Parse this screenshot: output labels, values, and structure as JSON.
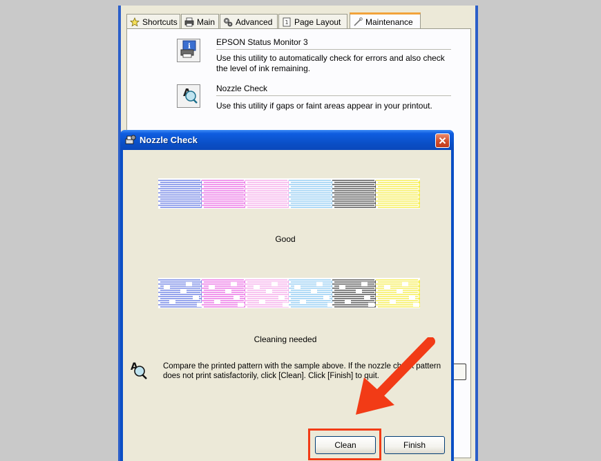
{
  "colors": {
    "backdrop": "#c9c9c9",
    "dialog_blue": "#0a4ec5",
    "highlight": "#f23b16",
    "arrow": "#f23b16"
  },
  "properties_window": {
    "tabs": [
      {
        "label": "Shortcuts",
        "icon": "star-icon"
      },
      {
        "label": "Main",
        "icon": "printer-icon"
      },
      {
        "label": "Advanced",
        "icon": "gears-icon"
      },
      {
        "label": "Page Layout",
        "icon": "page-layout-icon"
      },
      {
        "label": "Maintenance",
        "icon": "wrench-icon"
      }
    ],
    "active_tab": "Maintenance",
    "utilities": [
      {
        "title": "EPSON Status Monitor 3",
        "description": "Use this utility to automatically check for errors and also check the level of ink remaining.",
        "icon": "status-monitor-icon"
      },
      {
        "title": "Nozzle Check",
        "description": "Use this utility if gaps or faint areas appear in your printout.",
        "icon": "nozzle-check-icon"
      }
    ]
  },
  "dialog": {
    "title": "Nozzle Check",
    "title_icon": "printer-gear-icon",
    "close_icon": "close-icon",
    "good_label": "Good",
    "bad_label": "Cleaning needed",
    "pattern_colors": [
      "#2e49d8",
      "#e032d8",
      "#f28ae0",
      "#62b4ec",
      "#000000",
      "#f0e600"
    ],
    "instruction": "Compare the printed pattern with the sample above. If the nozzle check pattern does not print satisfactorily, click [Clean]. Click [Finish] to quit.",
    "instruction_icon": "nozzle-check-icon",
    "buttons": {
      "clean": "Clean",
      "finish": "Finish"
    }
  },
  "annotation": {
    "arrow_icon": "arrow-icon",
    "highlight_target": "Clean"
  }
}
